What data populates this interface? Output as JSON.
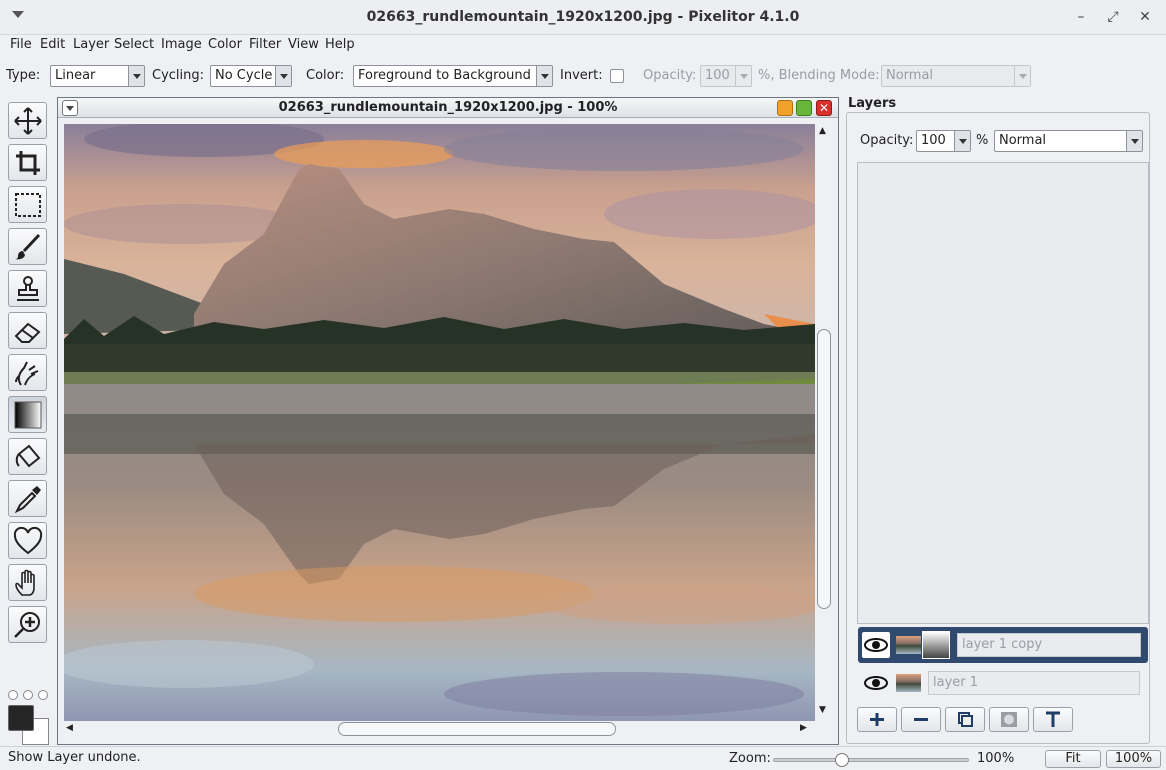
{
  "window": {
    "title": "02663_rundlemountain_1920x1200.jpg - Pixelitor 4.1.0",
    "min": "–",
    "max": "⤢",
    "close": "✕"
  },
  "menu": [
    "File",
    "Edit",
    "Layer",
    "Select",
    "Image",
    "Color",
    "Filter",
    "View",
    "Help"
  ],
  "options": {
    "type_label": "Type:",
    "type_value": "Linear",
    "cycling_label": "Cycling:",
    "cycling_value": "No Cycle",
    "color_label": "Color:",
    "color_value": "Foreground to Background",
    "invert_label": "Invert:",
    "opacity_label": "Opacity:",
    "opacity_value": "100",
    "blend_label": "%, Blending Mode:",
    "blend_value": "Normal"
  },
  "tools": [
    "move-tool",
    "crop-tool",
    "selection-tool",
    "brush-tool",
    "clone-stamp-tool",
    "eraser-tool",
    "smudge-tool",
    "gradient-tool",
    "paint-bucket-tool",
    "color-picker-tool",
    "shape-tool",
    "hand-tool",
    "zoom-tool"
  ],
  "image_window": {
    "title": "02663_rundlemountain_1920x1200.jpg - 100%"
  },
  "layers_panel": {
    "title": "Layers",
    "opacity_label": "Opacity:",
    "opacity_value": "100",
    "percent": "%",
    "blend_value": "Normal",
    "layers": [
      {
        "name": "layer 1 copy",
        "selected": true,
        "has_mask": true
      },
      {
        "name": "layer 1",
        "selected": false,
        "has_mask": false
      }
    ]
  },
  "status": {
    "message": "Show Layer undone.",
    "zoom_label": "Zoom:",
    "zoom_value": "100%",
    "fit_label": "Fit",
    "actual_label": "100%"
  },
  "colors": {
    "accent": "#2f4a6e",
    "close": "#d9302b",
    "minimize": "#f0a22a",
    "maximize": "#67b53a"
  }
}
